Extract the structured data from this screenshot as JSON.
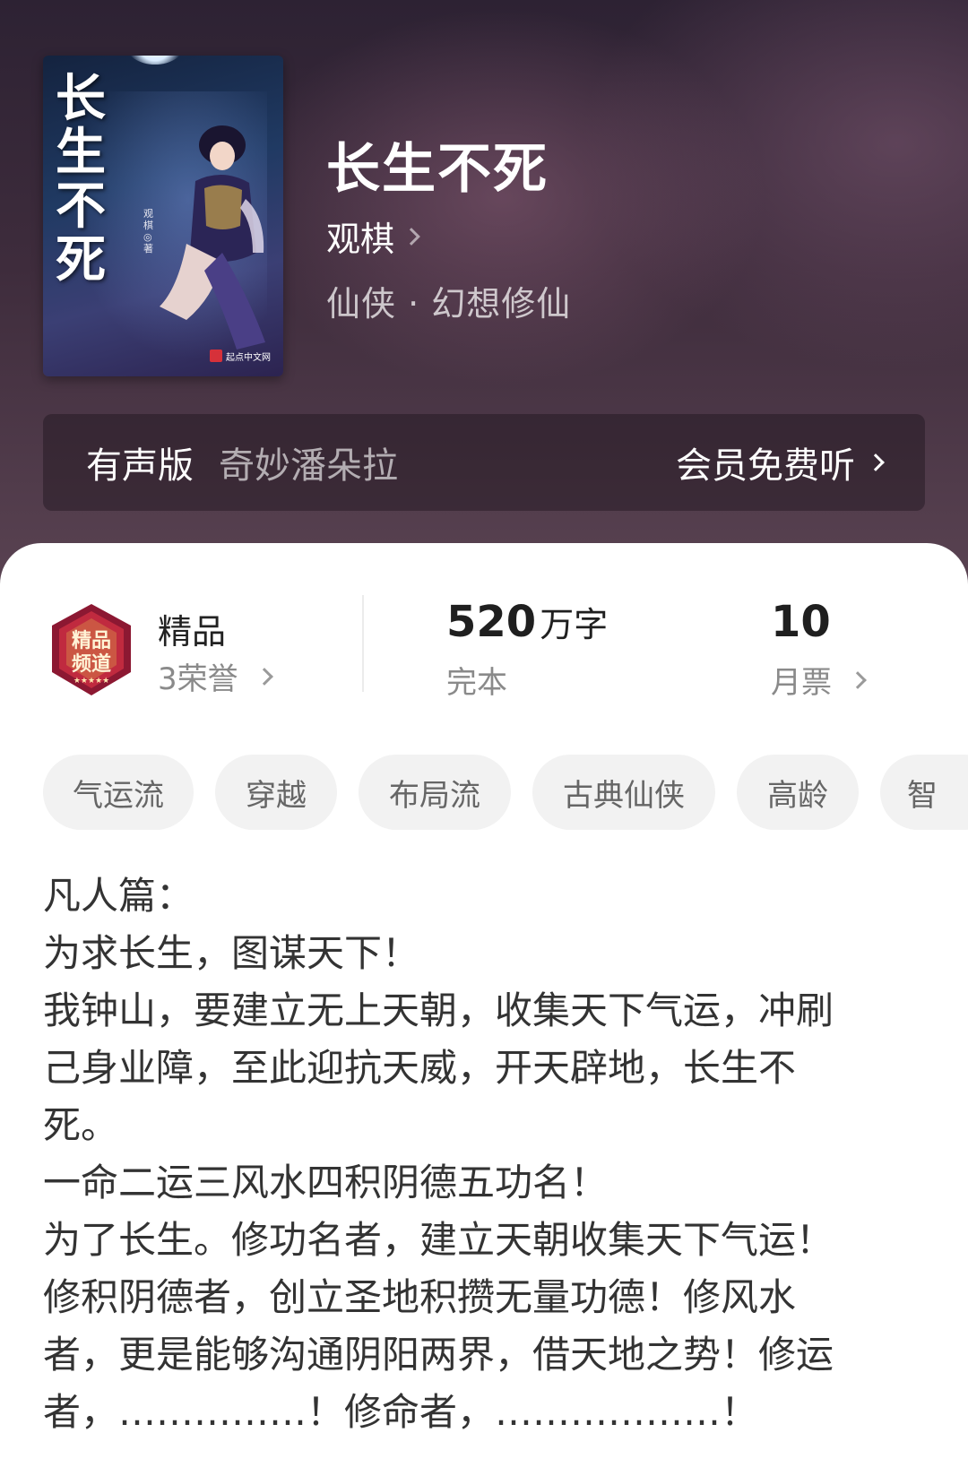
{
  "book": {
    "cover_title": "长生不死",
    "cover_author": "观棋◎著",
    "cover_publisher": "起点中文网",
    "title": "长生不死",
    "author": "观棋",
    "genre": "仙侠 · 幻想修仙"
  },
  "audio": {
    "label": "有声版",
    "narrator": "奇妙潘朵拉",
    "action": "会员免费听"
  },
  "honor": {
    "badge_text_top": "精品",
    "badge_text_bottom": "频道",
    "title": "精品",
    "count": "3荣誉"
  },
  "stats": {
    "words_value": "520",
    "words_unit": "万字",
    "status": "完本",
    "votes_value": "10",
    "votes_label": "月票"
  },
  "tags": [
    "气运流",
    "穿越",
    "布局流",
    "古典仙侠",
    "高龄",
    "智"
  ],
  "synopsis": [
    "凡人篇：",
    "为求长生，图谋天下！",
    "我钟山，要建立无上天朝，收集天下气运，冲刷",
    "己身业障，至此迎抗天威，开天辟地，长生不",
    "死。",
    "一命二运三风水四积阴德五功名！",
    "为了长生。修功名者，建立天朝收集天下气运！",
    "修积阴德者，创立圣地积攒无量功德！修风水",
    "者，更是能够沟通阴阳两界，借天地之势！修运",
    "者，……………！修命者，………………！"
  ],
  "icons": {
    "author_arrow": "chevron-right-icon",
    "audio_arrow": "chevron-right-icon",
    "honor_arrow": "chevron-right-icon",
    "votes_arrow": "chevron-right-icon",
    "badge": "premium-channel-badge-icon"
  },
  "colors": {
    "hero_bg": "#3e2c3c",
    "sheet_bg": "#ffffff",
    "tag_bg": "#f2f2f2",
    "badge_red": "#b8213a"
  }
}
